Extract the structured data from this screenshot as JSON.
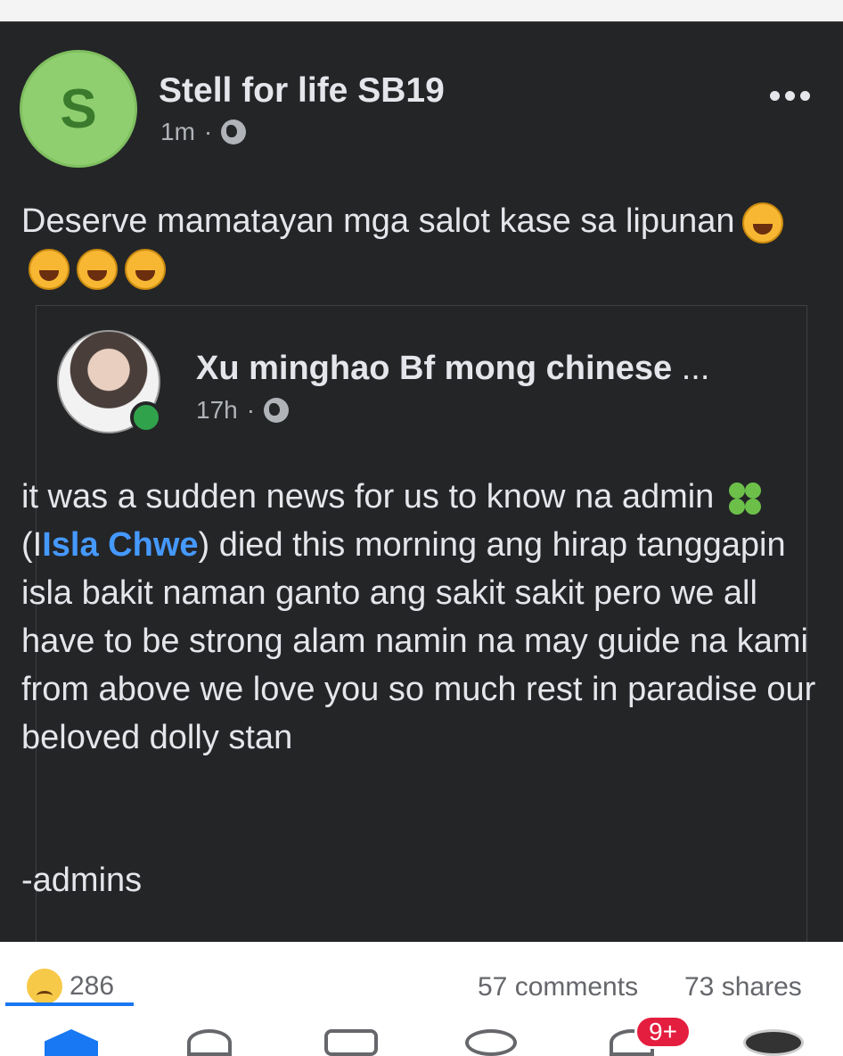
{
  "post": {
    "author": "Stell for life SB19",
    "avatar_initial": "S",
    "time": "1m",
    "separator": "·",
    "caption": "Deserve mamatayan mga salot kase sa lipunan",
    "caption_emoji": "rolling-on-floor-laughing-emoji x4"
  },
  "shared_post": {
    "author": "Xu minghao Bf mong chinese",
    "author_ellipsis": "...",
    "time": "17h",
    "separator": "·",
    "body_line1": "it was a sudden news for us to know na admin ",
    "body_mention_prefix": "(I",
    "body_mention": "Isla Chwe",
    "body_after_mention": ") died this morning ang hirap tanggapin isla bakit naman ganto ang sakit sakit pero we all have to be strong alam namin na may guide na kami from above we love you so much rest in paradise our beloved dolly stan",
    "signoff": "-admins"
  },
  "stats": {
    "reaction_count": "286",
    "comments": "57 comments",
    "shares": "73 shares"
  },
  "nav": {
    "notification_badge": "9+"
  },
  "colors": {
    "post_bg": "#242527",
    "text": "#e4e6eb",
    "meta": "#b0b3b8",
    "mention": "#4599ff",
    "accent": "#1877f2",
    "badge": "#e41e3f"
  }
}
